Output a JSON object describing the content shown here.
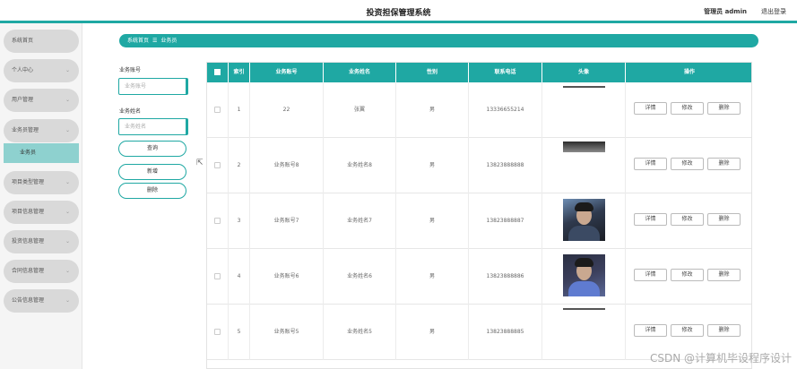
{
  "header": {
    "title": "投资担保管理系统",
    "user": "管理员 admin",
    "logout": "退出登录"
  },
  "sidebar": {
    "items": [
      {
        "label": "系统首页",
        "chevron": false
      },
      {
        "label": "个人中心",
        "chevron": true
      },
      {
        "label": "用户管理",
        "chevron": true
      },
      {
        "label": "业务员管理",
        "chevron": true
      },
      {
        "label": "项目类型管理",
        "chevron": true
      },
      {
        "label": "项目信息管理",
        "chevron": true
      },
      {
        "label": "投资信息管理",
        "chevron": true
      },
      {
        "label": "合同信息管理",
        "chevron": true
      },
      {
        "label": "公告信息管理",
        "chevron": true
      }
    ],
    "sub_item": "业务员",
    "chevron_glyph": "⌄"
  },
  "breadcrumb": {
    "home": "系统首页",
    "sep": "☰",
    "current": "业务员"
  },
  "filters": {
    "account_label": "业务账号",
    "account_placeholder": "业务账号",
    "name_label": "业务姓名",
    "name_placeholder": "业务姓名",
    "query": "查询",
    "add": "新增",
    "delete": "删除"
  },
  "table": {
    "headers": [
      "",
      "索引",
      "业务账号",
      "业务姓名",
      "性别",
      "联系电话",
      "头像",
      "操作"
    ],
    "rows": [
      {
        "index": "1",
        "account": "22",
        "name": "张翼",
        "gender": "男",
        "phone": "13336655214",
        "avatar": "strip"
      },
      {
        "index": "2",
        "account": "业务账号8",
        "name": "业务姓名8",
        "gender": "男",
        "phone": "13823888888",
        "avatar": "top"
      },
      {
        "index": "3",
        "account": "业务账号7",
        "name": "业务姓名7",
        "gender": "男",
        "phone": "13823888887",
        "avatar": "full"
      },
      {
        "index": "4",
        "account": "业务账号6",
        "name": "业务姓名6",
        "gender": "男",
        "phone": "13823888886",
        "avatar": "full2"
      },
      {
        "index": "5",
        "account": "业务账号5",
        "name": "业务姓名5",
        "gender": "男",
        "phone": "13823888885",
        "avatar": "strip"
      }
    ],
    "actions": {
      "detail": "详情",
      "edit": "修改",
      "delete": "删除"
    }
  },
  "watermark": "CSDN @计算机毕设程序设计"
}
